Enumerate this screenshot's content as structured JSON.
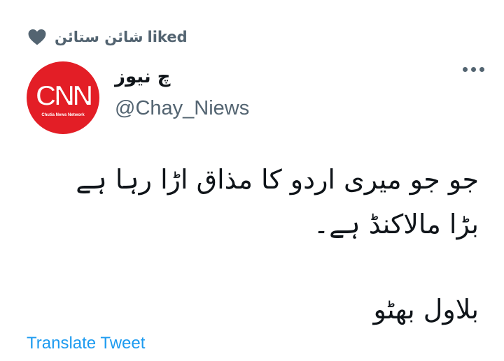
{
  "social_context": {
    "icon": "heart-icon",
    "name": "شائن ستائن",
    "action": "liked"
  },
  "author": {
    "avatar_logo_text": "CNN",
    "avatar_subtext": "Chutia News Network",
    "avatar_color": "#e31e26",
    "display_name": "چ نیوز",
    "handle": "@Chay_Niews"
  },
  "more_menu_icon": "more-horizontal-icon",
  "tweet": {
    "lines": [
      "جو جو میری اردو کا مذاق اڑا رہا ہے",
      "بڑا مالاکنڈ ہے۔"
    ],
    "signature": "بلاول بھٹو"
  },
  "translate_label": "Translate Tweet",
  "colors": {
    "text_primary": "#0f1419",
    "text_secondary": "#536471",
    "link": "#1d9bf0"
  }
}
